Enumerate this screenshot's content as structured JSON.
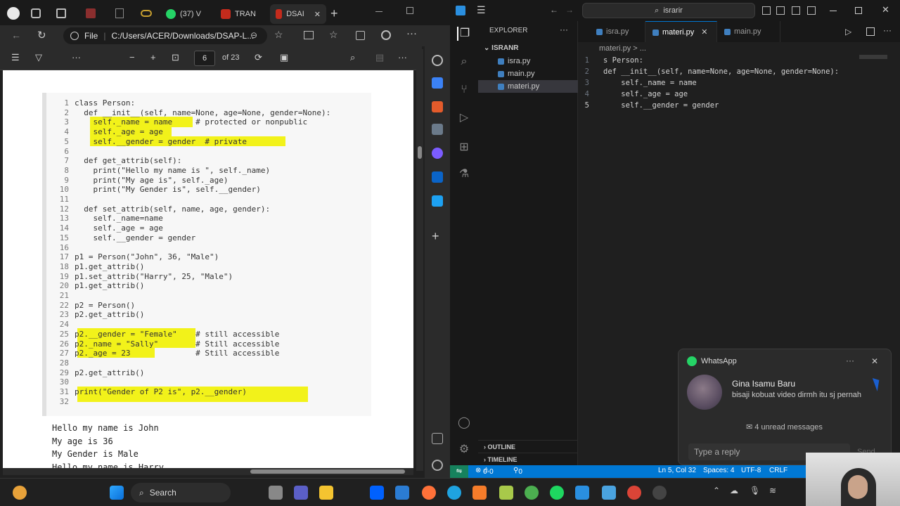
{
  "edge": {
    "tabs": [
      {
        "label": "(37) V",
        "icon": "whatsapp-icon"
      },
      {
        "label": "TRAN",
        "icon": "pdf-icon"
      },
      {
        "label": "DSAI",
        "icon": "pdf-icon"
      }
    ],
    "address": {
      "prefix": "File",
      "url": "C:/Users/ACER/Downloads/DSAP-L..."
    },
    "pdf": {
      "page_current": "6",
      "page_total": "of 23"
    },
    "code_lines": [
      {
        "n": "1",
        "t": "class Person:"
      },
      {
        "n": "2",
        "t": "  def __init__(self, name=None, age=None, gender=None):"
      },
      {
        "n": "3",
        "t": "    self._name = name     # protected or nonpublic"
      },
      {
        "n": "4",
        "t": "    self._age = age"
      },
      {
        "n": "5",
        "t": "    self.__gender = gender  # private"
      },
      {
        "n": "6",
        "t": ""
      },
      {
        "n": "7",
        "t": "  def get_attrib(self):"
      },
      {
        "n": "8",
        "t": "    print(\"Hello my name is \", self._name)"
      },
      {
        "n": "9",
        "t": "    print(\"My age is\", self._age)"
      },
      {
        "n": "10",
        "t": "    print(\"My Gender is\", self.__gender)"
      },
      {
        "n": "11",
        "t": ""
      },
      {
        "n": "12",
        "t": "  def set_attrib(self, name, age, gender):"
      },
      {
        "n": "13",
        "t": "    self._name=name"
      },
      {
        "n": "14",
        "t": "    self._age = age"
      },
      {
        "n": "15",
        "t": "    self.__gender = gender"
      },
      {
        "n": "16",
        "t": ""
      },
      {
        "n": "17",
        "t": "p1 = Person(\"John\", 36, \"Male\")"
      },
      {
        "n": "18",
        "t": "p1.get_attrib()"
      },
      {
        "n": "19",
        "t": "p1.set_attrib(\"Harry\", 25, \"Male\")"
      },
      {
        "n": "20",
        "t": "p1.get_attrib()"
      },
      {
        "n": "21",
        "t": ""
      },
      {
        "n": "22",
        "t": "p2 = Person()"
      },
      {
        "n": "23",
        "t": "p2.get_attrib()"
      },
      {
        "n": "24",
        "t": ""
      },
      {
        "n": "25",
        "t": "p2.__gender = \"Female\"    # still accessible"
      },
      {
        "n": "26",
        "t": "p2._name = \"Sally\"        # Still accessible"
      },
      {
        "n": "27",
        "t": "p2._age = 23              # Still accessible"
      },
      {
        "n": "28",
        "t": ""
      },
      {
        "n": "29",
        "t": "p2.get_attrib()"
      },
      {
        "n": "30",
        "t": ""
      },
      {
        "n": "31",
        "t": "print(\"Gender of P2 is\", p2.__gender)"
      },
      {
        "n": "32",
        "t": ""
      }
    ],
    "output_lines": [
      "Hello my name is  John",
      "My age is 36",
      "My Gender is Male",
      "Hello my name is  Harry"
    ]
  },
  "vscode": {
    "search": "israrir",
    "explorer_title": "EXPLORER",
    "folder": "ISRANR",
    "files": [
      "isra.py",
      "main.py",
      "materi.py"
    ],
    "tabs": [
      "isra.py",
      "materi.py",
      "main.py"
    ],
    "breadcrumb": "materi.py > ...",
    "outline": "OUTLINE",
    "timeline": "TIMELINE",
    "editor_lines": [
      {
        "n": "1",
        "t": "s Person:"
      },
      {
        "n": "2",
        "t": "def __init__(self, name=None, age=None, gender=None):"
      },
      {
        "n": "3",
        "t": "    self._name = name"
      },
      {
        "n": "4",
        "t": "    self._age = age"
      },
      {
        "n": "5",
        "t": "    self.__gender = gender"
      }
    ],
    "status": {
      "errors": "0",
      "warnings": "0",
      "ports": "0",
      "position": "Ln 5, Col 32",
      "spaces": "Spaces: 4",
      "encoding": "UTF-8",
      "eol": "CRLF"
    }
  },
  "whatsapp": {
    "app": "WhatsApp",
    "sender": "Gina Isamu Baru",
    "message": "bisaji kobuat video dirmh itu sj pernah",
    "unread": "4 unread messages",
    "reply_placeholder": "Type a reply",
    "send_label": "Send"
  },
  "taskbar": {
    "search": "Search"
  }
}
